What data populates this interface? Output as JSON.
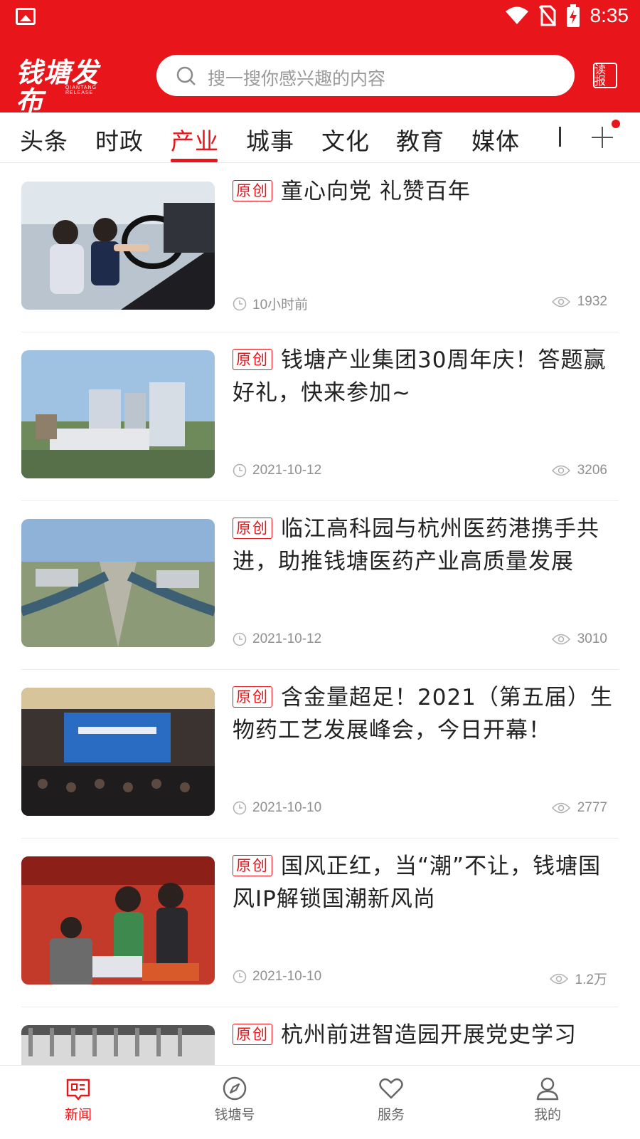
{
  "status_bar": {
    "time": "8:35"
  },
  "header": {
    "logo_text": "钱塘发布",
    "logo_subtext": "QIANTANG RELEASE",
    "search_placeholder": "搜一搜你感兴趣的内容",
    "read_paper_label": "读报"
  },
  "tabs": [
    {
      "label": "头条",
      "active": false
    },
    {
      "label": "时政",
      "active": false
    },
    {
      "label": "产业",
      "active": true
    },
    {
      "label": "城事",
      "active": false
    },
    {
      "label": "文化",
      "active": false
    },
    {
      "label": "教育",
      "active": false
    },
    {
      "label": "媒体",
      "active": false
    }
  ],
  "news": [
    {
      "badge": "原创",
      "title": "童心向党 礼赞百年",
      "time": "10小时前",
      "views": "1932",
      "thumb": "kids-in-car"
    },
    {
      "badge": "原创",
      "title": "钱塘产业集团30周年庆！答题赢好礼，快来参加~",
      "time": "2021-10-12",
      "views": "3206",
      "thumb": "office-towers"
    },
    {
      "badge": "原创",
      "title": "临江高科园与杭州医药港携手共进，助推钱塘医药产业高质量发展",
      "time": "2021-10-12",
      "views": "3010",
      "thumb": "aerial-park"
    },
    {
      "badge": "原创",
      "title": "含金量超足！2021（第五届）生物药工艺发展峰会，今日开幕！",
      "time": "2021-10-10",
      "views": "2777",
      "thumb": "conference-hall"
    },
    {
      "badge": "原创",
      "title": "国风正红，当“潮”不让，钱塘国风IP解锁国潮新风尚",
      "time": "2021-10-10",
      "views": "1.2万",
      "thumb": "guofeng-booth"
    },
    {
      "badge": "原创",
      "title": "杭州前进智造园开展党史学习",
      "time": "",
      "views": "",
      "thumb": "ceiling"
    }
  ],
  "bottom_nav": [
    {
      "label": "新闻",
      "icon": "news-icon",
      "active": true
    },
    {
      "label": "钱塘号",
      "icon": "compass-icon",
      "active": false
    },
    {
      "label": "服务",
      "icon": "heart-icon",
      "active": false
    },
    {
      "label": "我的",
      "icon": "user-icon",
      "active": false
    }
  ],
  "colors": {
    "brand_red": "#e8151b",
    "meta_gray": "#8f8f8f"
  }
}
